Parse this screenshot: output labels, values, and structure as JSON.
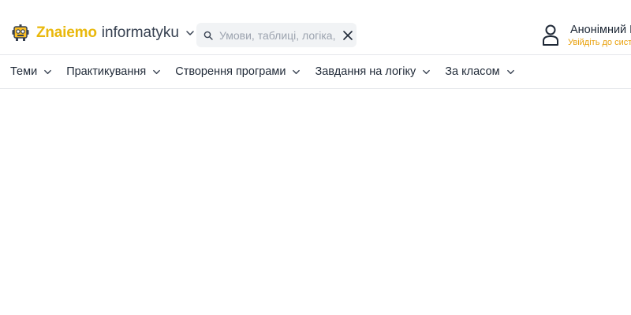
{
  "header": {
    "brand": "Znaiemo",
    "brand_sub": "informatyku",
    "brand_color": "#e9b80c"
  },
  "search": {
    "placeholder": "Умови, таблиці, логіка, Ру",
    "value": ""
  },
  "user": {
    "name": "Анонімний К",
    "login_hint": "Увійдіть до систе"
  },
  "nav": {
    "items": [
      {
        "label": "Теми"
      },
      {
        "label": "Практикування"
      },
      {
        "label": "Створення програми"
      },
      {
        "label": "Завдання на логіку"
      },
      {
        "label": "За класом"
      }
    ]
  },
  "icons": [
    "robot-logo-icon",
    "chevron-down-icon",
    "search-icon",
    "close-icon",
    "user-icon"
  ]
}
